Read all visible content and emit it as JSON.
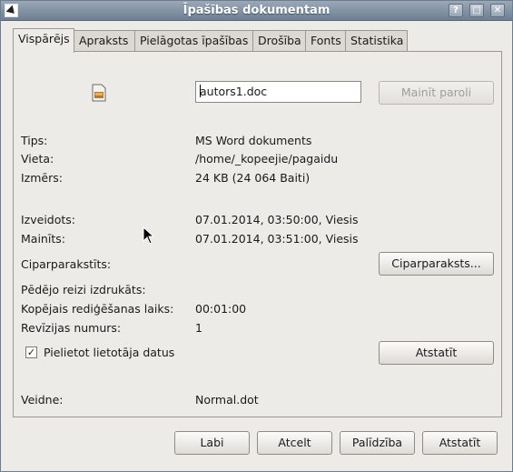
{
  "window": {
    "title": "Īpašības dokumentam",
    "controls": {
      "help": "?",
      "maximize": "□",
      "close": "✕"
    }
  },
  "tabs": [
    {
      "label": "Vispārējs",
      "active": true
    },
    {
      "label": "Apraksts",
      "active": false
    },
    {
      "label": "Pielāgotas īpašības",
      "active": false
    },
    {
      "label": "Drošība",
      "active": false
    },
    {
      "label": "Fonts",
      "active": false
    },
    {
      "label": "Statistika",
      "active": false
    }
  ],
  "general": {
    "file_icon": "document-icon",
    "filename": "autors1.doc",
    "change_password_label": "Mainīt paroli",
    "type_label": "Tips:",
    "type_value": "MS Word dokuments",
    "location_label": "Vieta:",
    "location_value": "/home/_kopeejie/pagaidu",
    "size_label": "Izmērs:",
    "size_value": "24 KB (24 064 Baiti)",
    "created_label": "Izveidots:",
    "created_value": "07.01.2014, 03:50:00, Viesis",
    "modified_label": "Mainīts:",
    "modified_value": "07.01.2014, 03:51:00, Viesis",
    "signature_label": "Ciparparakstīts:",
    "signature_button": "Ciparparaksts...",
    "printed_label": "Pēdējo reizi izdrukāts:",
    "editing_time_label": "Kopējais rediģēšanas laiks:",
    "editing_time_value": "00:01:00",
    "revision_label": "Revīzijas numurs:",
    "revision_value": "1",
    "apply_user_data_label": "Pielietot lietotāja datus",
    "apply_user_data_checked": true,
    "reset_button": "Atstatīt",
    "template_label": "Veidne:",
    "template_value": "Normal.dot"
  },
  "footer": {
    "ok_label": "Labi",
    "cancel_label": "Atcelt",
    "help_label": "Palīdzība",
    "reset_label": "Atstatīt"
  }
}
